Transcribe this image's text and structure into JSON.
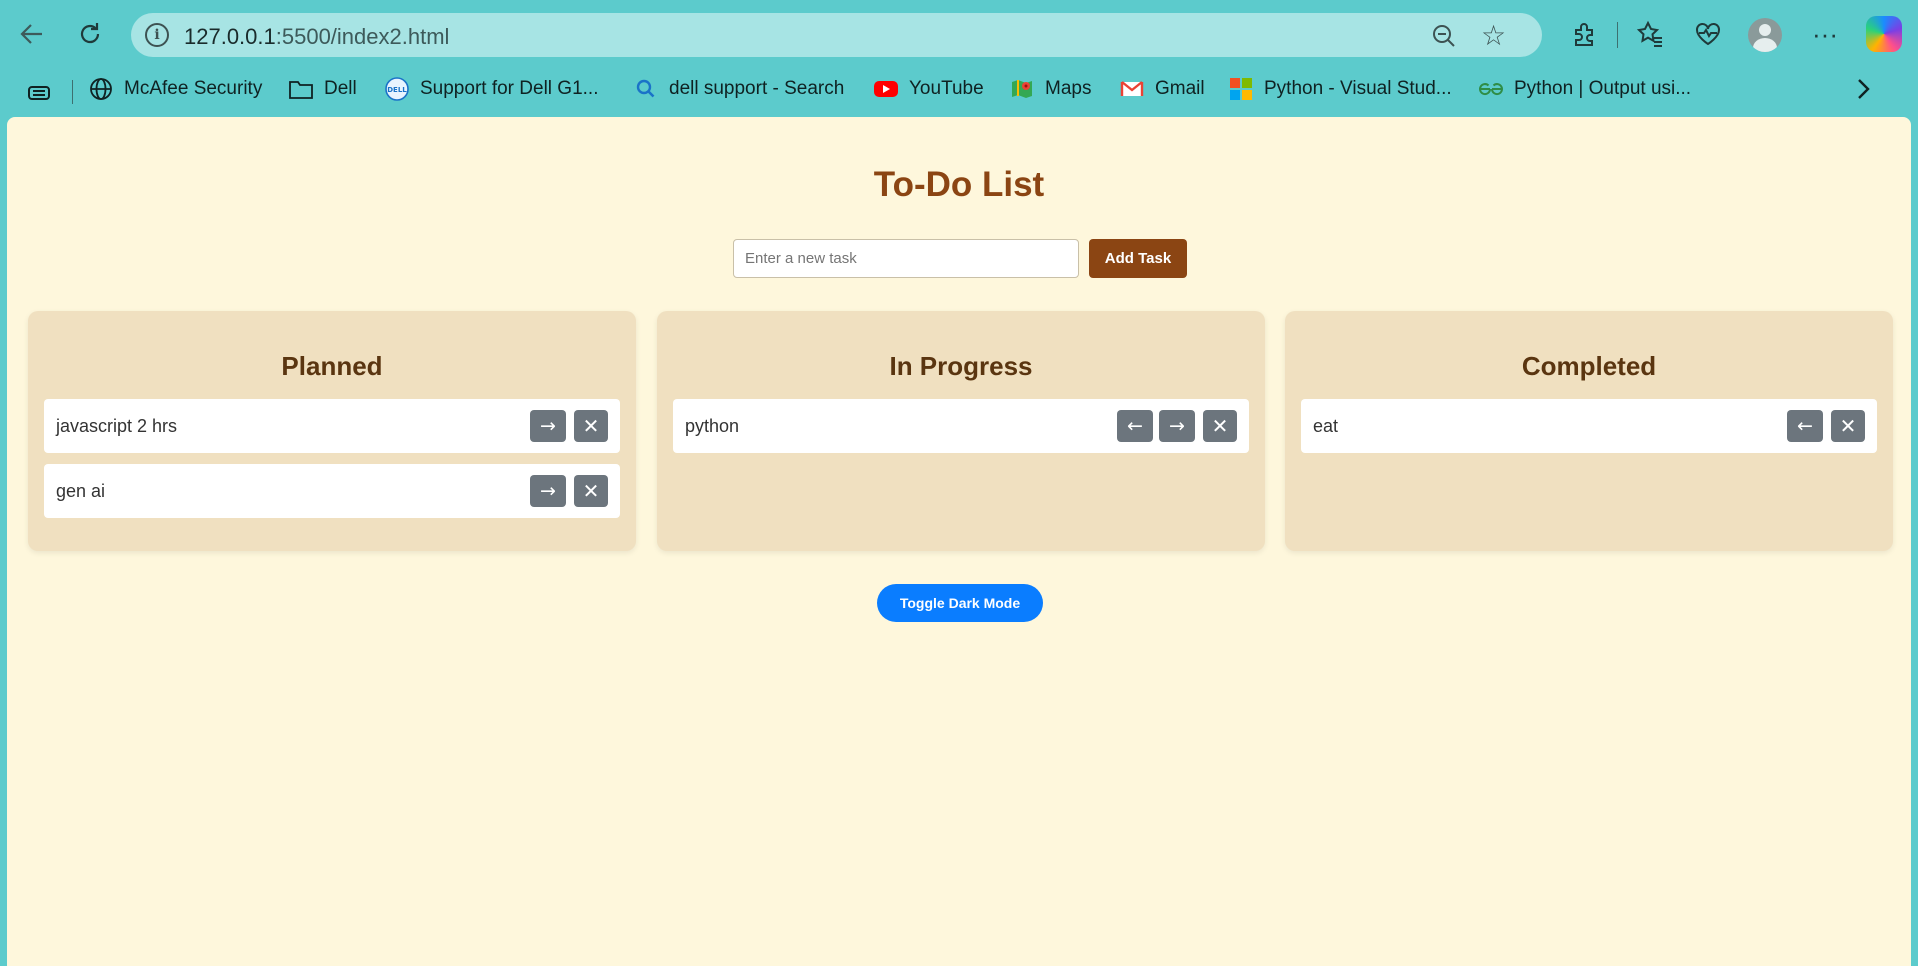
{
  "browser": {
    "url_host": "127.0.0.1",
    "url_rest": ":5500/index2.html"
  },
  "bookmarks": [
    {
      "label": "McAfee Security",
      "icon": "globe-icon"
    },
    {
      "label": "Dell",
      "icon": "folder-icon"
    },
    {
      "label": "Support for Dell G1...",
      "icon": "dell-icon"
    },
    {
      "label": "dell support - Search",
      "icon": "search-icon"
    },
    {
      "label": "YouTube",
      "icon": "youtube-icon"
    },
    {
      "label": "Maps",
      "icon": "maps-icon"
    },
    {
      "label": "Gmail",
      "icon": "gmail-icon"
    },
    {
      "label": "Python - Visual Stud...",
      "icon": "microsoft-icon"
    },
    {
      "label": "Python | Output usi...",
      "icon": "geeksforgeeks-icon"
    }
  ],
  "app": {
    "title": "To-Do List",
    "input_placeholder": "Enter a new task",
    "add_button": "Add Task",
    "toggle_button": "Toggle Dark Mode"
  },
  "columns": [
    {
      "title": "Planned",
      "tasks": [
        "javascript 2 hrs",
        "gen ai"
      ]
    },
    {
      "title": "In Progress",
      "tasks": [
        "python"
      ]
    },
    {
      "title": "Completed",
      "tasks": [
        "eat"
      ]
    }
  ],
  "buttons": {
    "move_right": "→",
    "move_left": "←",
    "delete": "✕"
  },
  "colors": {
    "accent": "#8b4513",
    "page_bg": "#fef7dc",
    "column_bg": "#f0e0c0",
    "toggle": "#0a7dff",
    "task_button": "#6c757d"
  }
}
